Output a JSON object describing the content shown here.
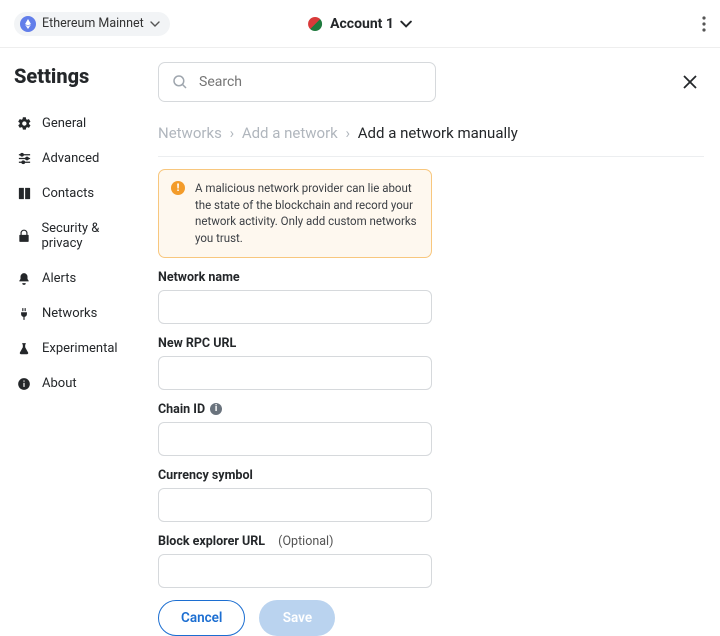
{
  "topbar": {
    "network": "Ethereum Mainnet",
    "account": "Account 1"
  },
  "settings_title": "Settings",
  "sidebar": {
    "items": [
      {
        "label": "General"
      },
      {
        "label": "Advanced"
      },
      {
        "label": "Contacts"
      },
      {
        "label": "Security & privacy"
      },
      {
        "label": "Alerts"
      },
      {
        "label": "Networks"
      },
      {
        "label": "Experimental"
      },
      {
        "label": "About"
      }
    ]
  },
  "search": {
    "placeholder": "Search"
  },
  "breadcrumbs": {
    "a": "Networks",
    "b": "Add a network",
    "c": "Add a network manually"
  },
  "alert": "A malicious network provider can lie about the state of the blockchain and record your network activity. Only add custom networks you trust.",
  "form": {
    "network_name": {
      "label": "Network name",
      "value": ""
    },
    "rpc_url": {
      "label": "New RPC URL",
      "value": ""
    },
    "chain_id": {
      "label": "Chain ID",
      "value": ""
    },
    "currency": {
      "label": "Currency symbol",
      "value": ""
    },
    "explorer": {
      "label": "Block explorer URL",
      "optional": "(Optional)",
      "value": ""
    }
  },
  "buttons": {
    "cancel": "Cancel",
    "save": "Save"
  }
}
